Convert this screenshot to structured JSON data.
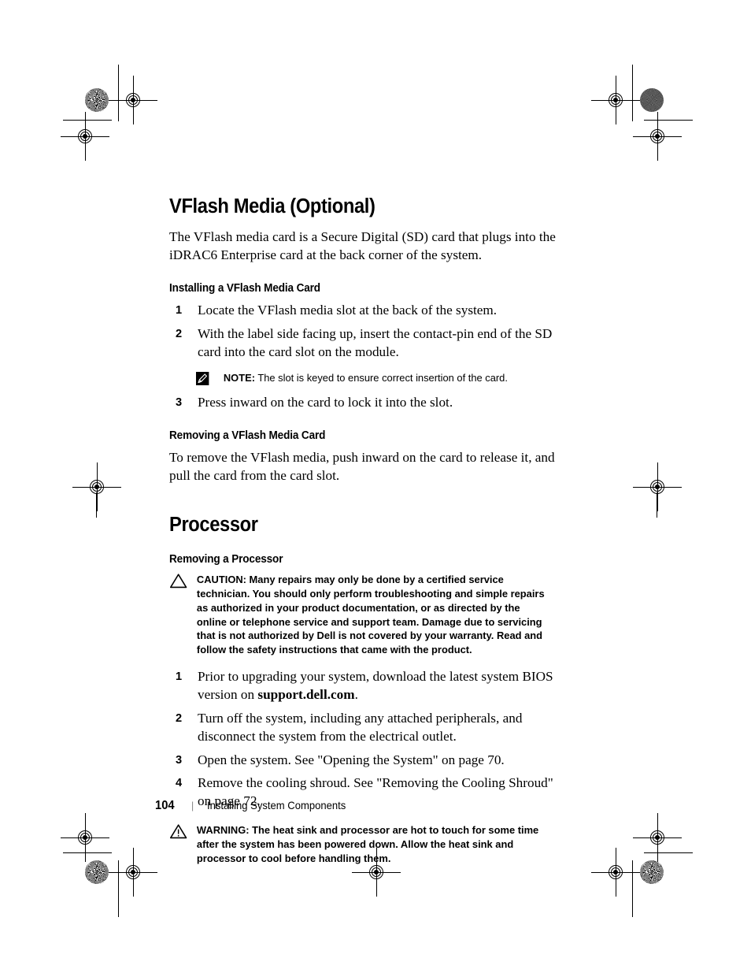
{
  "document": {
    "chapter_title": "VFlash Media (Optional)",
    "intro_paragraph": "The VFlash media card is a Secure Digital (SD) card that plugs into the iDRAC6 Enterprise card at the back corner of the system.",
    "processor_title": "Processor"
  },
  "sections": {
    "installing": {
      "heading": "Installing a VFlash Media Card",
      "steps": [
        {
          "num": "1",
          "text": "Locate the VFlash media slot at the back of the system."
        },
        {
          "num": "2",
          "text": "With the label side facing up, insert the contact-pin end of the SD card into the card slot on the module."
        },
        {
          "num": "3",
          "text": "Press inward on the card to lock it into the slot."
        }
      ]
    },
    "removing_vflash": {
      "heading": "Removing a VFlash Media Card",
      "paragraph": "To remove the VFlash media, push inward on the card to release it, and pull the card from the card slot."
    },
    "removing_processor": {
      "heading": "Removing a Processor",
      "steps": [
        {
          "num": "1",
          "text_before": "Prior to upgrading your system, download the latest system BIOS version on ",
          "bold": "support.dell.com",
          "text_after": "."
        },
        {
          "num": "2",
          "text": "Turn off the system, including any attached peripherals, and disconnect the system from the electrical outlet."
        },
        {
          "num": "3",
          "text": "Open the system. See \"Opening the System\" on page 70."
        },
        {
          "num": "4",
          "text": "Remove the cooling shroud. See \"Removing the Cooling Shroud\" on page 72."
        }
      ]
    }
  },
  "admonitions": {
    "note": {
      "label": "NOTE:",
      "text": " The slot is keyed to ensure correct insertion of the card.",
      "icon": "note-pencil-icon"
    },
    "caution": {
      "label": "CAUTION:",
      "text": " Many repairs may only be done by a certified service technician. You should only perform troubleshooting and simple repairs as authorized in your product documentation, or as directed by the online or telephone service and support team. Damage due to servicing that is not authorized by Dell is not covered by your warranty. Read and follow the safety instructions that came with the product.",
      "icon": "caution-triangle-icon"
    },
    "warning": {
      "label": "WARNING:",
      "text": " The heat sink and processor are hot to touch for some time after the system has been powered down. Allow the heat sink and processor to cool before handling them.",
      "icon": "warning-triangle-exclamation-icon"
    }
  },
  "footer": {
    "page_number": "104",
    "separator": "|",
    "section_title": "Installing System Components"
  },
  "print_marks": {
    "colors": {
      "ink": "#000000",
      "halftone_gray": "#5a5a5a"
    }
  }
}
